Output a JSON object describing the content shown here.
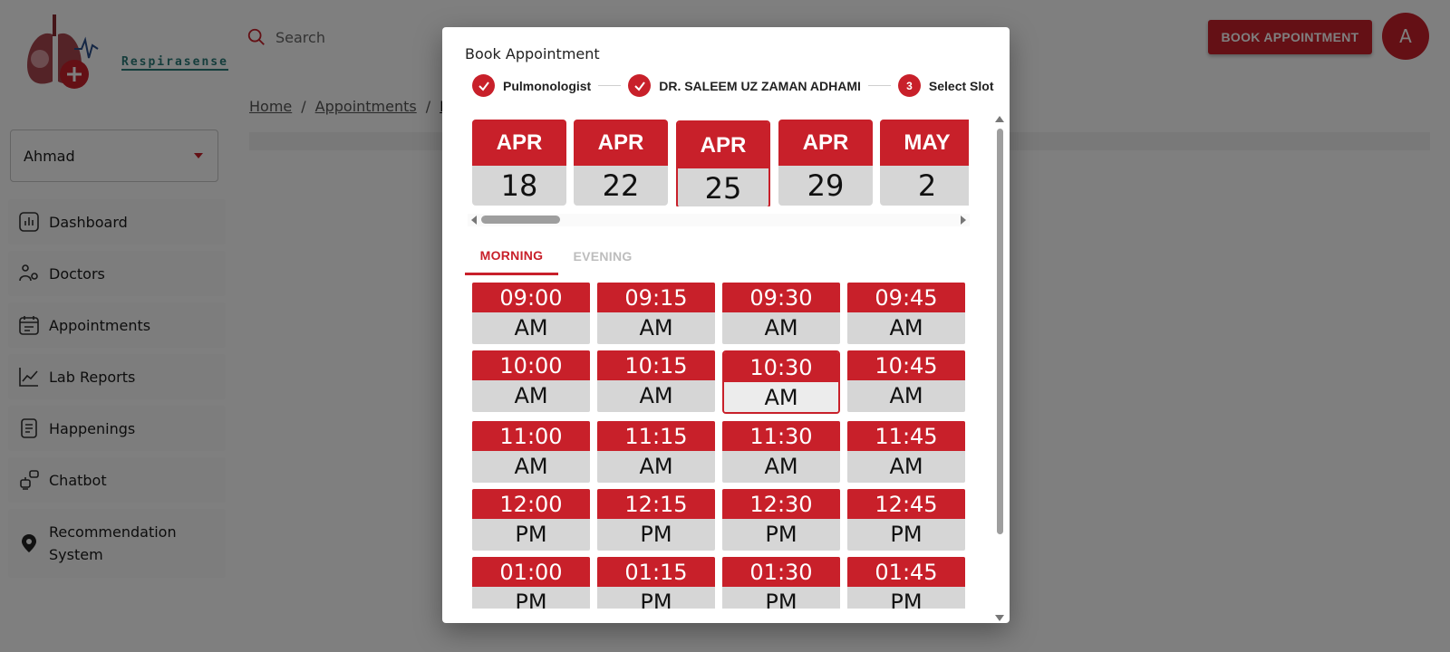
{
  "app": {
    "logo_text": "Respirasense",
    "search_placeholder": "Search",
    "book_appointment_label": "BOOK APPOINTMENT",
    "avatar_initial": "A"
  },
  "breadcrumb": {
    "home": "Home",
    "appointments": "Appointments",
    "current": "Ne",
    "separator": "/"
  },
  "sidebar": {
    "patient_select_value": "Ahmad",
    "items": [
      {
        "label": "Dashboard",
        "icon": "chart-icon"
      },
      {
        "label": "Doctors",
        "icon": "doctor-icon"
      },
      {
        "label": "Appointments",
        "icon": "calendar-icon"
      },
      {
        "label": "Lab Reports",
        "icon": "line-chart-icon"
      },
      {
        "label": "Happenings",
        "icon": "document-icon"
      },
      {
        "label": "Chatbot",
        "icon": "robot-icon"
      },
      {
        "label": "Recommendation System",
        "icon": "location-pin-icon"
      }
    ]
  },
  "modal": {
    "title": "Book Appointment",
    "steps": [
      {
        "label": "Pulmonologist",
        "state": "completed"
      },
      {
        "label": "DR. SALEEM UZ ZAMAN ADHAMI",
        "state": "completed"
      },
      {
        "label": "Select Slot",
        "state": "active",
        "number": "3"
      }
    ],
    "dates": [
      {
        "month": "APR",
        "day": "18"
      },
      {
        "month": "APR",
        "day": "22"
      },
      {
        "month": "APR",
        "day": "25",
        "selected": true
      },
      {
        "month": "APR",
        "day": "29"
      },
      {
        "month": "MAY",
        "day": "2"
      }
    ],
    "tabs": [
      {
        "label": "MORNING",
        "active": true
      },
      {
        "label": "EVENING",
        "active": false
      }
    ],
    "slots": [
      {
        "time": "09:00",
        "period": "AM"
      },
      {
        "time": "09:15",
        "period": "AM"
      },
      {
        "time": "09:30",
        "period": "AM"
      },
      {
        "time": "09:45",
        "period": "AM"
      },
      {
        "time": "10:00",
        "period": "AM"
      },
      {
        "time": "10:15",
        "period": "AM"
      },
      {
        "time": "10:30",
        "period": "AM",
        "selected": true
      },
      {
        "time": "10:45",
        "period": "AM"
      },
      {
        "time": "11:00",
        "period": "AM"
      },
      {
        "time": "11:15",
        "period": "AM"
      },
      {
        "time": "11:30",
        "period": "AM"
      },
      {
        "time": "11:45",
        "period": "AM"
      },
      {
        "time": "12:00",
        "period": "PM"
      },
      {
        "time": "12:15",
        "period": "PM"
      },
      {
        "time": "12:30",
        "period": "PM"
      },
      {
        "time": "12:45",
        "period": "PM"
      },
      {
        "time": "01:00",
        "period": "PM"
      },
      {
        "time": "01:15",
        "period": "PM"
      },
      {
        "time": "01:30",
        "period": "PM"
      },
      {
        "time": "01:45",
        "period": "PM"
      }
    ]
  },
  "colors": {
    "accent": "#c8202a",
    "card_bottom": "#d6d6d6",
    "logo_text": "#2a7a78"
  }
}
